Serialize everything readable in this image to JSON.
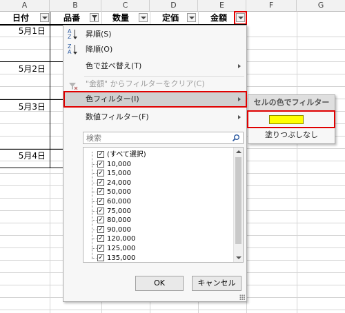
{
  "columns": [
    "A",
    "B",
    "C",
    "D",
    "E",
    "F",
    "G"
  ],
  "headers": {
    "date": "日付",
    "item": "品番",
    "qty": "数量",
    "price": "定価",
    "amount": "金額"
  },
  "dates": [
    "5月1日",
    "5月2日",
    "5月3日",
    "5月4日"
  ],
  "menu": {
    "sort_asc": "昇順(S)",
    "sort_desc": "降順(O)",
    "sort_by_color": "色で並べ替え(T)",
    "clear_filter": "\"金額\" からフィルターをクリア(C)",
    "color_filter": "色フィルター(I)",
    "number_filter": "数値フィルター(F)",
    "search_placeholder": "検索",
    "select_all": "(すべて選択)",
    "values": [
      "10,000",
      "15,000",
      "24,000",
      "50,000",
      "60,000",
      "75,000",
      "80,000",
      "90,000",
      "120,000",
      "125,000",
      "135,000"
    ],
    "ok": "OK",
    "cancel": "キャンセル"
  },
  "submenu": {
    "title": "セルの色でフィルター",
    "swatch_color": "#ffff00",
    "no_fill": "塗りつぶしなし"
  },
  "colors": {
    "highlight_border": "#e00000",
    "menu_highlight": "#d0d0d0"
  }
}
